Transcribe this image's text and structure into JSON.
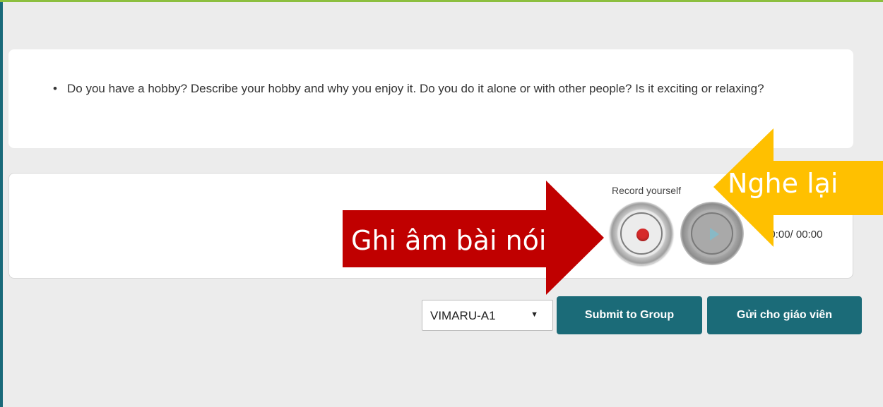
{
  "question": {
    "text": "Do you have a hobby? Describe your hobby and why you enjoy it. Do you do it alone or with other people? Is it exciting or relaxing?"
  },
  "recorder": {
    "label": "Record yourself",
    "time": "00:00/ 00:00"
  },
  "group_select": {
    "value": "VIMARU-A1"
  },
  "buttons": {
    "submit_group": "Submit to Group",
    "send_teacher": "Gửi cho giáo viên"
  },
  "annotations": {
    "record_arrow": "Ghi âm bài nói",
    "listen_arrow": "Nghe lại",
    "record_arrow_color": "#c00000",
    "listen_arrow_color": "#ffc000"
  },
  "colors": {
    "accent": "#1b6b78",
    "top_line": "#8cbf3f"
  }
}
